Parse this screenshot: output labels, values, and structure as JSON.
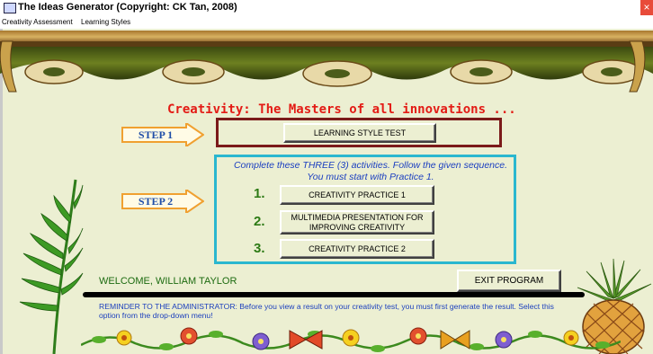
{
  "window": {
    "title": "The Ideas Generator (Copyright: CK Tan, 2008)",
    "close_glyph": "×"
  },
  "menu": [
    {
      "label": "Creativity Assessment"
    },
    {
      "label": "Learning Styles"
    }
  ],
  "headline": "Creativity: The Masters of all innovations ...",
  "step1": {
    "label": "STEP 1",
    "button": "LEARNING STYLE TEST"
  },
  "step2": {
    "label": "STEP 2",
    "instructions": "Complete these THREE (3) activities. Follow the given sequence. You must start with Practice 1.",
    "items": [
      {
        "number": "1.",
        "button": "CREATIVITY PRACTICE 1"
      },
      {
        "number": "2.",
        "button": "MULTIMEDIA PRESENTATION FOR IMPROVING CREATIVITY"
      },
      {
        "number": "3.",
        "button": "CREATIVITY PRACTICE 2"
      }
    ]
  },
  "welcome": "WELCOME, WILLIAM TAYLOR",
  "exit_button": "EXIT PROGRAM",
  "reminder": "REMINDER TO THE ADMINISTRATOR: Before you view a result on your creativity test, you must first generate the result. Select this option from the drop-down menu!",
  "colors": {
    "background": "#ecefd2",
    "headline": "#e31b15",
    "step_label": "#1f4ea8",
    "step1_border": "#7b1a1a",
    "step2_border": "#2ab7cf",
    "arrow": "#f0a030",
    "instructions": "#1a3ec0",
    "numbers": "#2c7a14"
  },
  "icons": [
    "app-icon",
    "close-icon",
    "awning-decoration",
    "step-arrow",
    "leaf-vine",
    "pineapple",
    "flower-border"
  ]
}
